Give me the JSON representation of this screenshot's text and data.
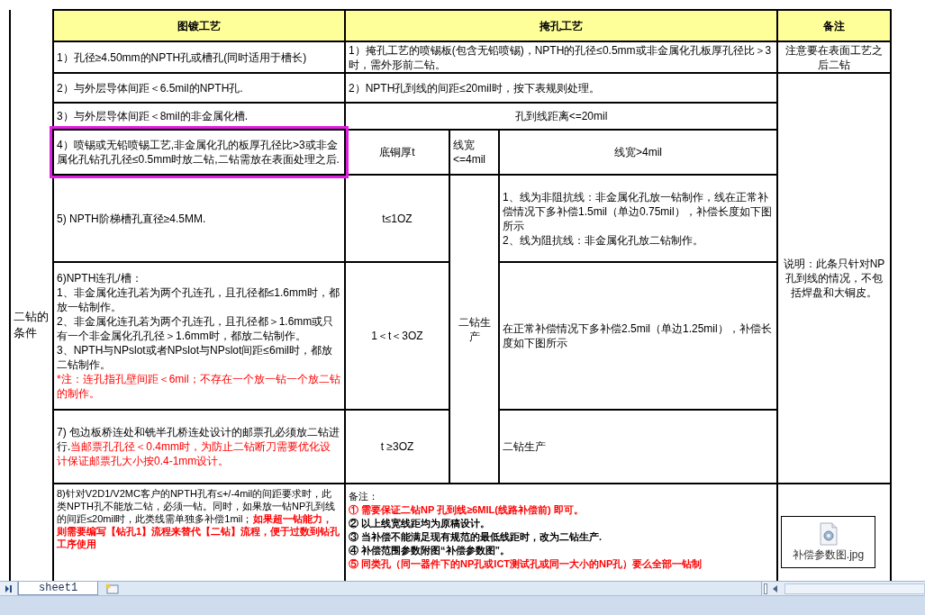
{
  "row_label": "二钻的条件",
  "columns": [
    "图镀工艺",
    "掩孔工艺",
    "备注"
  ],
  "plating_conditions": [
    {
      "highlighted": false,
      "paragraphs": [
        [
          {
            "text": "1）孔径≥4.50mm的NPTH孔或槽孔(同时适用于槽长)",
            "color": "#000000",
            "bold": false
          }
        ]
      ]
    },
    {
      "highlighted": false,
      "paragraphs": [
        [
          {
            "text": "2）与外层导体间距＜6.5mil的NPTH孔.",
            "color": "#000000",
            "bold": false
          }
        ]
      ]
    },
    {
      "highlighted": false,
      "paragraphs": [
        [
          {
            "text": "3）与外层导体间距＜8mil的非金属化槽.",
            "color": "#000000",
            "bold": false
          }
        ]
      ]
    },
    {
      "highlighted": true,
      "paragraphs": [
        [
          {
            "text": "4）喷锡或无铅喷锡工艺,非金属化孔的板厚孔径比>3或非金属化孔钻孔孔径≤0.5mm时放二钻,二钻需放在表面处理之后.",
            "color": "#000000",
            "bold": false
          }
        ]
      ]
    },
    {
      "highlighted": false,
      "paragraphs": [
        [
          {
            "text": "5) NPTH阶梯槽孔直径≥4.5MM.",
            "color": "#000000",
            "bold": false
          }
        ]
      ]
    },
    {
      "highlighted": false,
      "paragraphs": [
        [
          {
            "text": "6)NPTH连孔/槽：",
            "color": "#000000",
            "bold": false
          }
        ],
        [
          {
            "text": "1、非金属化连孔若为两个孔连孔，且孔径都≤1.6mm时，都放一钻制作。",
            "color": "#000000",
            "bold": false
          }
        ],
        [
          {
            "text": "2、非金属化连孔若为两个孔连孔，且孔径都＞1.6mm或只有一个非金属化孔孔径＞1.6mm时，都放二钻制作。",
            "color": "#000000",
            "bold": false
          }
        ],
        [
          {
            "text": "3、NPTH与NPslot或者NPslot与NPslot间距≤6mil时，都放二钻制作。",
            "color": "#000000",
            "bold": false
          }
        ],
        [
          {
            "text": "*注：连孔指孔壁间距＜6mil；不存在一个放一钻一个放二钻的制作。",
            "color": "#ff0000",
            "bold": false
          }
        ]
      ]
    },
    {
      "highlighted": false,
      "paragraphs": [
        [
          {
            "text": "7) 包边板桥连处和铣半孔桥连处设计的邮票孔必须放二钻进行.",
            "color": "#000000",
            "bold": false
          },
          {
            "text": "当邮票孔孔径＜0.4mm时，为防止二钻断刀需要优化设计保证邮票孔大小按0.4-1mm设计。",
            "color": "#ff0000",
            "bold": false
          }
        ]
      ]
    },
    {
      "highlighted": false,
      "paragraphs": [
        [
          {
            "text": "8)针对V2D1/V2MC客户的NPTH孔有≤+/-4mil的间距要求时，此类NPTH孔不能放二钻，必须一钻。同时，如果放一钻NP孔到线的间距≤20mil时，此类线需单独多补偿1mil；",
            "color": "#000000",
            "bold": false
          },
          {
            "text": "如果超一钻能力，则需要编写【钻孔1】流程来替代【二钻】流程，便于过数到钻孔工序使用",
            "color": "#ff0000",
            "bold": true
          }
        ]
      ]
    }
  ],
  "masking": {
    "rule_1": "1）掩孔工艺的喷锡板(包含无铅喷锡)，NPTH的孔径≤0.5mm或非金属化孔板厚孔径比＞3时，需外形前二钻。",
    "rule_2": "2）NPTH孔到线的间距≤20mil时，按下表规则处理。",
    "subheader": "孔到线距离<=20mil",
    "table_columns": [
      "底铜厚t",
      "线宽<=4mil",
      "线宽>4mil"
    ],
    "narrow_line_result": "二钻生产",
    "thickness_rows": [
      {
        "thickness": "t≤1OZ",
        "wide_line": [
          "1、线为非阻抗线：非金属化孔放一钻制作，线在正常补偿情况下多补偿1.5mil（单边0.75mil），补偿长度如下图所示",
          "2、线为阻抗线：非金属化孔放二钻制作。"
        ]
      },
      {
        "thickness": "1＜t＜3OZ",
        "wide_line": [
          "在正常补偿情况下多补偿2.5mil（单边1.25mil），补偿长度如下图所示"
        ]
      },
      {
        "thickness": "t  ≥3OZ",
        "wide_line": [
          "二钻生产"
        ]
      }
    ]
  },
  "remarks": {
    "rule_1_note": "注意要在表面工艺之后二钻",
    "scope_note": "说明：此条只针对NP孔到线的情况，不包括焊盘和大铜皮。"
  },
  "footnotes": {
    "title": "备注：",
    "items": [
      {
        "text": "① 需要保证二钻NP 孔到线≥6MIL(线路补偿前) 即可。",
        "color": "#ff0000"
      },
      {
        "text": "② 以上线宽线距均为原稿设计。",
        "color": "#000000"
      },
      {
        "text": "③ 当补偿不能满足现有规范的最低线距时，改为二钻生产.",
        "color": "#000000"
      },
      {
        "text": "④ 补偿范围参数附图“补偿参数图”。",
        "color": "#000000"
      },
      {
        "text": "⑤ 同类孔（同一器件下的NP孔或ICT测试孔或同一大小的NP孔）要么全部一钻制",
        "color": "#ff0000"
      }
    ]
  },
  "attachment": {
    "file_name": "补偿参数图.jpg"
  },
  "sheet_tabs": [
    {
      "label": "sheet1",
      "selected": true
    }
  ]
}
